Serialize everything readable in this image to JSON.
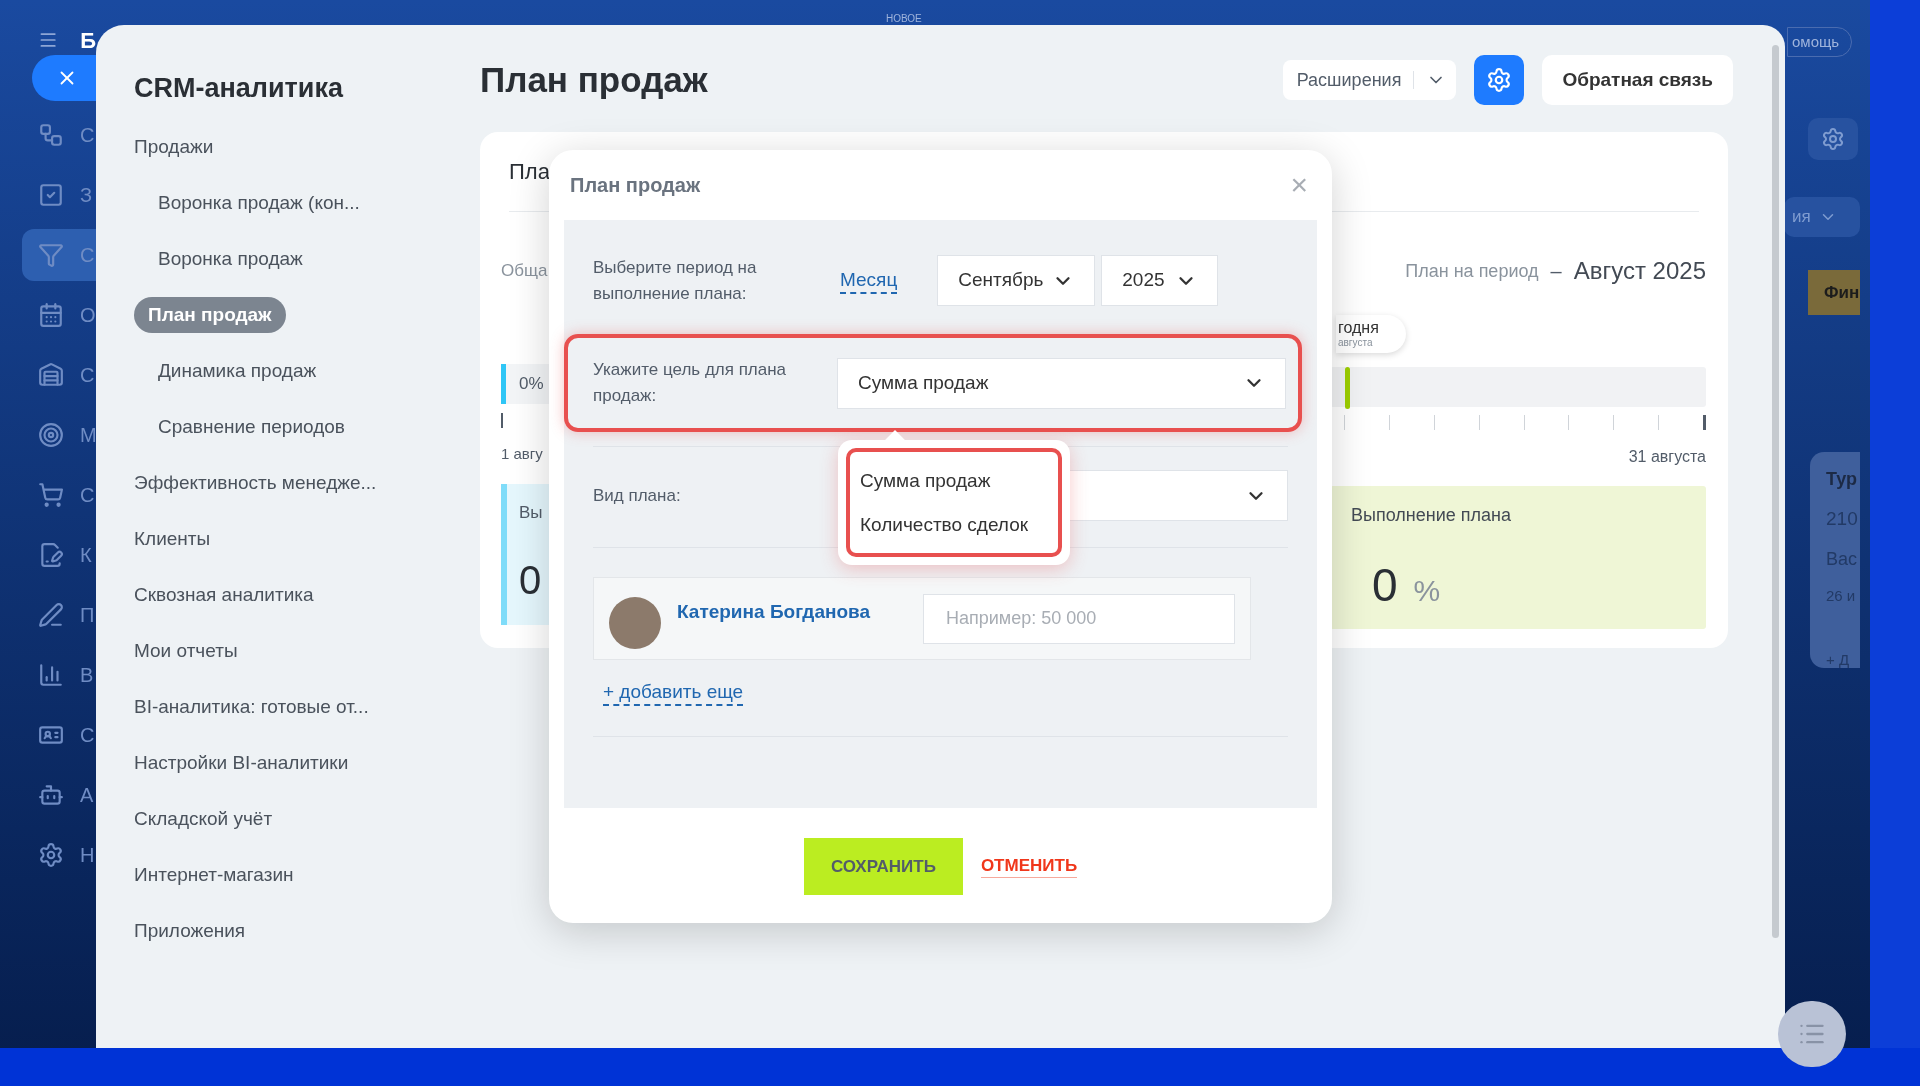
{
  "background_app": {
    "logo_letter": "Б",
    "top_badge": "НОВОЕ",
    "help_button": "омощь",
    "sidebar": [
      {
        "letter": "С",
        "selected": false
      },
      {
        "letter": "З",
        "selected": false
      },
      {
        "letter": "С",
        "selected": true
      },
      {
        "letter": "О",
        "selected": false
      },
      {
        "letter": "С",
        "selected": false
      },
      {
        "letter": "М",
        "selected": false
      },
      {
        "letter": "С",
        "selected": false
      },
      {
        "letter": "К",
        "selected": false
      },
      {
        "letter": "П",
        "selected": false
      },
      {
        "letter": "В",
        "selected": false
      },
      {
        "letter": "С",
        "selected": false
      },
      {
        "letter": "А",
        "selected": false
      },
      {
        "letter": "Н",
        "selected": false
      }
    ],
    "view_dropdown": "ия",
    "stage_label": "Фин",
    "deal_card": {
      "title": "Тур",
      "amount": "210",
      "contact": "Вас",
      "date": "26 и",
      "add": "+ Д"
    }
  },
  "panel": {
    "title": "CRM-аналитика",
    "nav": [
      {
        "label": "Продажи",
        "selected": false,
        "children": [
          {
            "label": "Воронка продаж (кон...",
            "selected": false
          },
          {
            "label": "Воронка продаж",
            "selected": false
          },
          {
            "label": "План продаж",
            "selected": true
          },
          {
            "label": "Динамика продаж",
            "selected": false
          },
          {
            "label": "Сравнение периодов",
            "selected": false
          }
        ]
      },
      {
        "label": "Эффективность менедже...",
        "selected": false
      },
      {
        "label": "Клиенты",
        "selected": false
      },
      {
        "label": "Сквозная аналитика",
        "selected": false
      },
      {
        "label": "Мои отчеты",
        "selected": false
      },
      {
        "label": "BI-аналитика: готовые от...",
        "selected": false
      },
      {
        "label": "Настройки BI-аналитики",
        "selected": false
      },
      {
        "label": "Складской учёт",
        "selected": false
      },
      {
        "label": "Интернет-магазин",
        "selected": false
      },
      {
        "label": "Приложения",
        "selected": false
      }
    ],
    "page_title": "План продаж",
    "extensions_button": "Расширения",
    "feedback_button": "Обратная связь",
    "card": {
      "title": "Пла",
      "total_label": "Обща",
      "progress_percent": "0%",
      "start_date": "1 авгу",
      "left_card_title": "Вы",
      "left_card_value": "0",
      "period_label": "План на период",
      "period_dash": "–",
      "period_value": "Август 2025",
      "today_label": "годня",
      "today_date": "августа",
      "timeline": {
        "level": 0.04
      },
      "end_date": "31 августа",
      "result_title": "Выполнение плана",
      "result_value": "0",
      "result_unit": "%"
    }
  },
  "dialog": {
    "title": "План продаж",
    "close": "×",
    "period_label": "Выберите период на выполнение плана:",
    "period_type": "Месяц",
    "month": "Сентябрь",
    "year": "2025",
    "goal_label": "Укажите цель для плана продаж:",
    "goal_value": "Сумма продаж",
    "goal_highlighted": true,
    "goal_options": [
      {
        "label": "Сумма продаж"
      },
      {
        "label": "Количество сделок"
      }
    ],
    "goal_options_highlighted": true,
    "plan_type_label": "Вид плана:",
    "employees": [
      {
        "name": "Катерина Богданова",
        "placeholder": "Например: 50 000"
      }
    ],
    "add_more": "+ добавить еще",
    "save": "СОХРАНИТЬ",
    "cancel": "ОТМЕНИТЬ"
  }
}
